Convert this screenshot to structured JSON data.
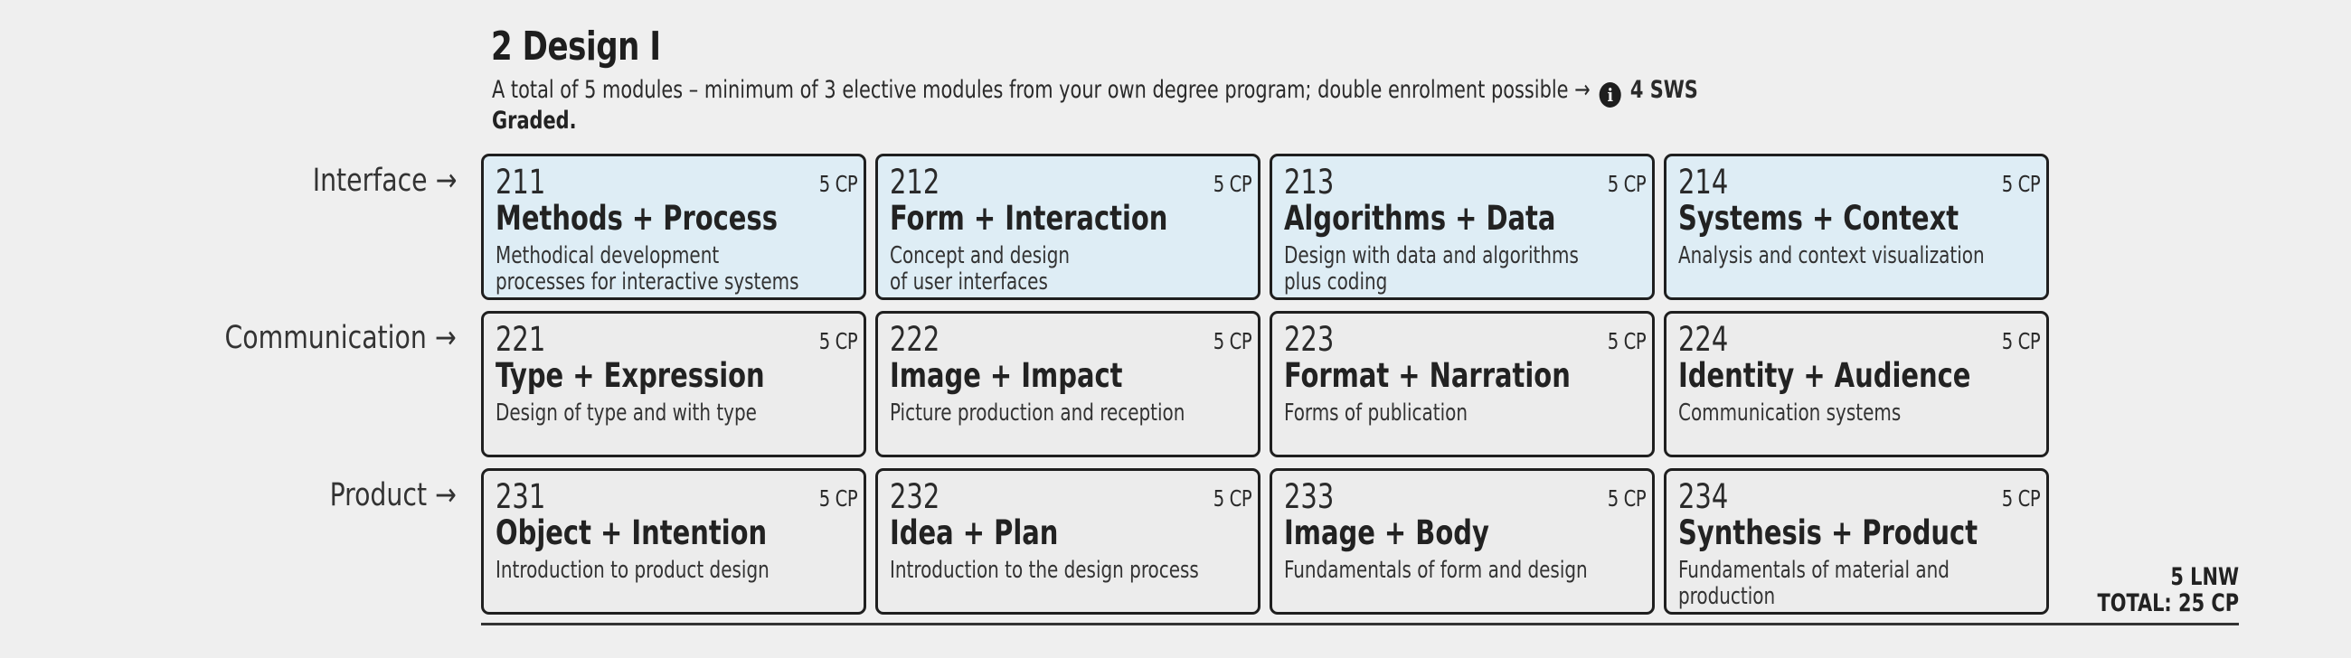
{
  "header": {
    "title": "2 Design I",
    "subtitle_text": "A total of 5 modules – minimum of 3 elective modules from your own degree program; double enrolment possible →",
    "info_icon": "info-icon",
    "sws": "4 SWS",
    "graded": "Graded."
  },
  "rows": [
    {
      "label": "Interface",
      "arrow": "→"
    },
    {
      "label": "Communication",
      "arrow": "→"
    },
    {
      "label": "Product",
      "arrow": "→"
    }
  ],
  "modules": [
    [
      {
        "code": "211",
        "cp": "5 CP",
        "name": "Methods + Process",
        "desc": "Methodical development\nprocesses for interactive systems"
      },
      {
        "code": "212",
        "cp": "5 CP",
        "name": "Form + Interaction",
        "desc": "Concept and design\nof user interfaces"
      },
      {
        "code": "213",
        "cp": "5 CP",
        "name": "Algorithms + Data",
        "desc": "Design with data and algorithms\nplus coding"
      },
      {
        "code": "214",
        "cp": "5 CP",
        "name": "Systems + Context",
        "desc": "Analysis and context visualization"
      }
    ],
    [
      {
        "code": "221",
        "cp": "5 CP",
        "name": "Type + Expression",
        "desc": "Design of type and with type"
      },
      {
        "code": "222",
        "cp": "5 CP",
        "name": "Image + Impact",
        "desc": "Picture production and reception"
      },
      {
        "code": "223",
        "cp": "5 CP",
        "name": "Format + Narration",
        "desc": "Forms of publication"
      },
      {
        "code": "224",
        "cp": "5 CP",
        "name": "Identity + Audience",
        "desc": "Communication systems"
      }
    ],
    [
      {
        "code": "231",
        "cp": "5 CP",
        "name": "Object + Intention",
        "desc": "Introduction to product design"
      },
      {
        "code": "232",
        "cp": "5 CP",
        "name": "Idea + Plan",
        "desc": "Introduction to the design process"
      },
      {
        "code": "233",
        "cp": "5 CP",
        "name": "Image + Body",
        "desc": "Fundamentals of form and design"
      },
      {
        "code": "234",
        "cp": "5 CP",
        "name": "Synthesis + Product",
        "desc": "Fundamentals of material and\nproduction"
      }
    ]
  ],
  "totals": {
    "lnw": "5 LNW",
    "total": "TOTAL: 25 CP"
  },
  "colors": {
    "interface_card_bg": "#deedf5",
    "card_bg": "#ececec",
    "border": "#1f1f1f",
    "page_bg": "#efefef"
  }
}
